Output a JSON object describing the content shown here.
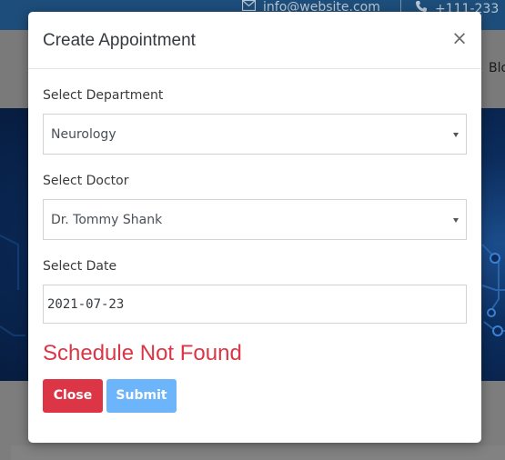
{
  "background": {
    "email": "info@website.com",
    "phone": "+111-233",
    "nav_link": "Blo"
  },
  "modal": {
    "title": "Create Appointment",
    "close_icon": "×",
    "department": {
      "label": "Select Department",
      "value": "Neurology"
    },
    "doctor": {
      "label": "Select Doctor",
      "value": "Dr. Tommy Shank"
    },
    "date": {
      "label": "Select Date",
      "value": "2021-07-23"
    },
    "error": "Schedule Not Found",
    "close_button": "Close",
    "submit_button": "Submit"
  },
  "colors": {
    "danger": "#dc3545",
    "primary_disabled": "#6cb5fb",
    "topbar": "#1d4d7a",
    "hero": "#0b2c5c"
  },
  "icons": {
    "email": "envelope-icon",
    "phone": "phone-icon",
    "close": "close-icon",
    "select_caret": "chevron-down-icon"
  }
}
